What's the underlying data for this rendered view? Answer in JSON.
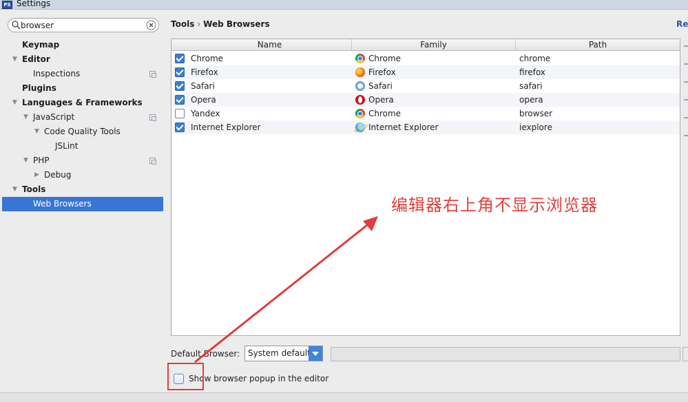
{
  "window": {
    "title": "Settings",
    "icon_label": "PS"
  },
  "search": {
    "value": "browser"
  },
  "tree": [
    {
      "label": "Keymap",
      "bold": true,
      "level": 0,
      "arrow": "",
      "proj": false
    },
    {
      "label": "Editor",
      "bold": true,
      "level": 0,
      "arrow": "down",
      "proj": false
    },
    {
      "label": "Inspections",
      "bold": false,
      "level": 1,
      "arrow": "",
      "proj": true
    },
    {
      "label": "Plugins",
      "bold": true,
      "level": 0,
      "arrow": "",
      "proj": false
    },
    {
      "label": "Languages & Frameworks",
      "bold": true,
      "level": 0,
      "arrow": "down",
      "proj": false
    },
    {
      "label": "JavaScript",
      "bold": false,
      "level": 1,
      "arrow": "down",
      "proj": true
    },
    {
      "label": "Code Quality Tools",
      "bold": false,
      "level": 2,
      "arrow": "down",
      "proj": false
    },
    {
      "label": "JSLint",
      "bold": false,
      "level": 3,
      "arrow": "",
      "proj": false
    },
    {
      "label": "PHP",
      "bold": false,
      "level": 1,
      "arrow": "down",
      "proj": true
    },
    {
      "label": "Debug",
      "bold": false,
      "level": 2,
      "arrow": "right",
      "proj": false
    },
    {
      "label": "Tools",
      "bold": true,
      "level": 0,
      "arrow": "down",
      "proj": false
    },
    {
      "label": "Web Browsers",
      "bold": false,
      "level": 1,
      "arrow": "",
      "proj": false,
      "selected": true
    }
  ],
  "breadcrumb": {
    "parent": "Tools",
    "separator": "›",
    "current": "Web Browsers"
  },
  "reset_label": "Res",
  "table": {
    "columns": [
      "Name",
      "Family",
      "Path"
    ],
    "rows": [
      {
        "checked": true,
        "name": "Chrome",
        "family": "Chrome",
        "family_icon": "chrome",
        "path": "chrome"
      },
      {
        "checked": true,
        "name": "Firefox",
        "family": "Firefox",
        "family_icon": "firefox",
        "path": "firefox"
      },
      {
        "checked": true,
        "name": "Safari",
        "family": "Safari",
        "family_icon": "safari",
        "path": "safari"
      },
      {
        "checked": true,
        "name": "Opera",
        "family": "Opera",
        "family_icon": "opera",
        "path": "opera"
      },
      {
        "checked": false,
        "name": "Yandex",
        "family": "Chrome",
        "family_icon": "chrome",
        "path": "browser"
      },
      {
        "checked": true,
        "name": "Internet Explorer",
        "family": "Internet Explorer",
        "family_icon": "ie",
        "path": "iexplore"
      }
    ]
  },
  "default_browser": {
    "label": "Default Browser:",
    "value": "System default"
  },
  "popup": {
    "label": "Show browser popup in the editor",
    "checked": false
  },
  "annotation": {
    "text": "编辑器右上角不显示浏览器",
    "color": "#e0403b"
  }
}
